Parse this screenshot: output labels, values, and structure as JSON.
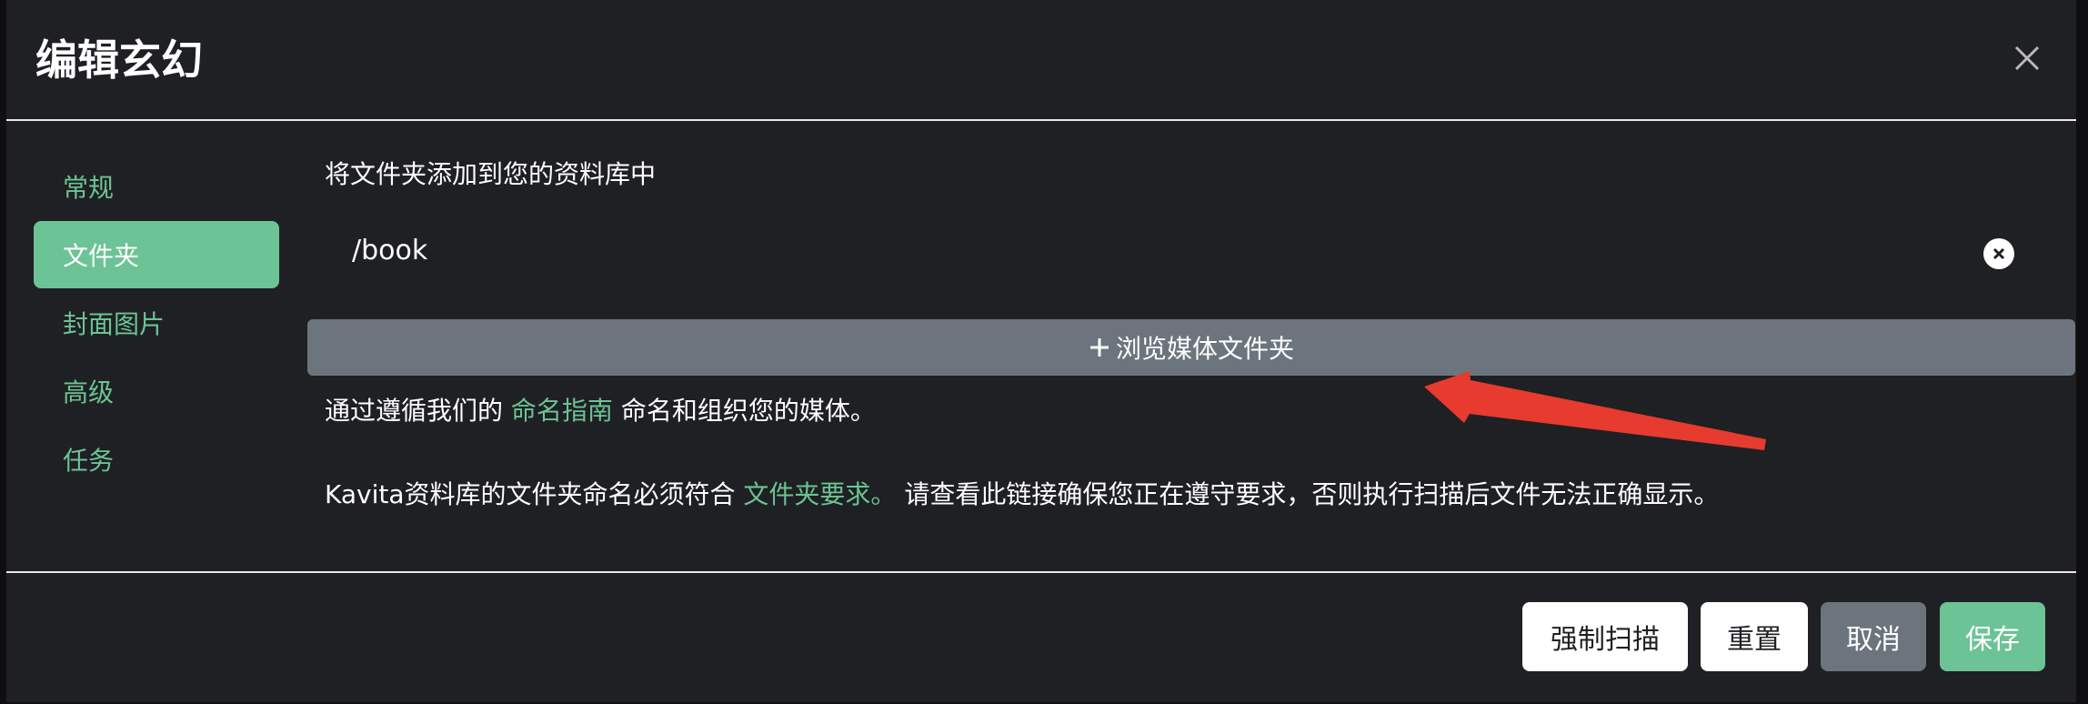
{
  "modal": {
    "title": "编辑玄幻",
    "close_icon": "close-icon"
  },
  "nav": {
    "items": [
      {
        "label": "常规",
        "active": false
      },
      {
        "label": "文件夹",
        "active": true
      },
      {
        "label": "封面图片",
        "active": false
      },
      {
        "label": "高级",
        "active": false
      },
      {
        "label": "任务",
        "active": false
      }
    ]
  },
  "folders": {
    "intro": "将文件夹添加到您的资料库中",
    "paths": [
      "/book"
    ],
    "remove_icon": "remove-circle-icon",
    "browse_label": "浏览媒体文件夹",
    "browse_icon": "plus-icon"
  },
  "help": {
    "line1_prefix": "通过遵循我们的",
    "line1_link": "命名指南",
    "line1_suffix": "命名和组织您的媒体。",
    "line2_prefix": "Kavita资料库的文件夹命名必须符合",
    "line2_link": "文件夹要求。",
    "line2_suffix": "请查看此链接确保您正在遵守要求，否则执行扫描后文件无法正确显示。"
  },
  "footer": {
    "force_scan": "强制扫描",
    "reset": "重置",
    "cancel": "取消",
    "save": "保存"
  },
  "colors": {
    "accent": "#6cc395",
    "secondary": "#6c757d",
    "background": "#1f2023",
    "annotation_arrow": "#e63b2e"
  }
}
